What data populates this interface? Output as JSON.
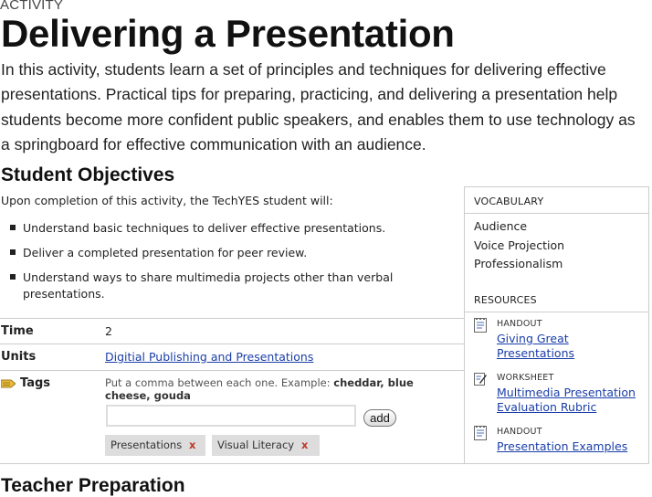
{
  "activity": {
    "eyebrow": "ACTIVITY",
    "title": "Delivering a Presentation",
    "intro": "In this activity, students learn a set of principles and techniques for delivering effective presentations. Practical tips for preparing, practicing, and delivering a presentation help students become more confident public speakers, and enables them to use technology as a springboard for effective communication with an audience."
  },
  "objectives": {
    "heading": "Student Objectives",
    "intro": "Upon completion of this activity, the TechYES student will:",
    "items": [
      "Understand basic techniques to deliver effective presentations.",
      "Deliver a completed presentation for peer review.",
      "Understand ways to share multimedia projects other than verbal presentations."
    ]
  },
  "meta": {
    "time_label": "Time",
    "time_value": "2",
    "units_label": "Units",
    "units_value": "Digitial Publishing and Presentations",
    "tags_label": "Tags",
    "tags_hint_prefix": "Put a comma between each one. Example: ",
    "tags_hint_example": "cheddar, blue cheese, gouda",
    "tag_input_value": "",
    "add_label": "add",
    "tags": [
      "Presentations",
      "Visual Literacy"
    ],
    "remove_glyph": "x"
  },
  "sidebar": {
    "vocab_heading": "VOCABULARY",
    "vocab": [
      "Audience",
      "Voice Projection",
      "Professionalism"
    ],
    "resources_heading": "RESOURCES",
    "resources": [
      {
        "type": "HANDOUT",
        "title": "Giving Great Presentations",
        "icon": "handout-icon"
      },
      {
        "type": "WORKSHEET",
        "title": "Multimedia Presentation Evaluation Rubric",
        "icon": "worksheet-icon"
      },
      {
        "type": "HANDOUT",
        "title": "Presentation Examples",
        "icon": "handout-icon"
      }
    ]
  },
  "next_section": {
    "heading": "Teacher Preparation"
  },
  "colors": {
    "link": "#1a3ea8",
    "remove": "#c0392b",
    "chip_bg": "#dddddd",
    "border": "#cccccc"
  }
}
